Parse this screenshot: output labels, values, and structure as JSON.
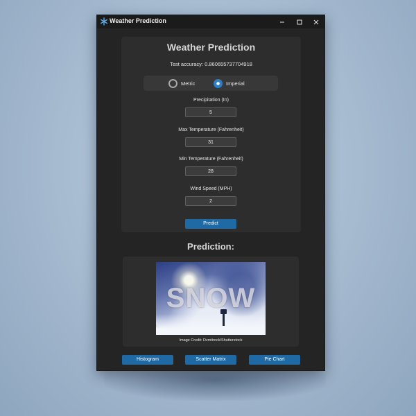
{
  "window": {
    "title": "Weather Prediction",
    "minimize_glyph": "–",
    "maximize_glyph": "☐",
    "close_glyph": "✕",
    "icon": "snowflake-icon"
  },
  "form": {
    "heading": "Weather Prediction",
    "accuracy_text": "Test accuracy: 0.860655737704918",
    "units": {
      "options": [
        "Metric",
        "Imperial"
      ],
      "selected": "Imperial"
    },
    "fields": [
      {
        "label": "Precipitation (In)",
        "value": "5"
      },
      {
        "label": "Max Temperature (Fahrenheit)",
        "value": "31"
      },
      {
        "label": "Min Temperature (Fahrenheit)",
        "value": "28"
      },
      {
        "label": "Wind Speed (MPH)",
        "value": "2"
      }
    ],
    "predict_label": "Predict"
  },
  "prediction": {
    "heading": "Prediction:",
    "result_word": "SNOW",
    "image_credit": "Image Credit: Dzmitrock/Shutterstock"
  },
  "buttons": {
    "histogram": "Histogram",
    "scatter_matrix": "Scatter Matrix",
    "pie_chart": "Pie Chart"
  },
  "colors": {
    "accent": "#1f6aa5",
    "radio_selected": "#2f7fc4",
    "window_bg": "#242424",
    "panel_bg": "#2d2d2d",
    "desktop_bg": "#a9bdd2"
  }
}
